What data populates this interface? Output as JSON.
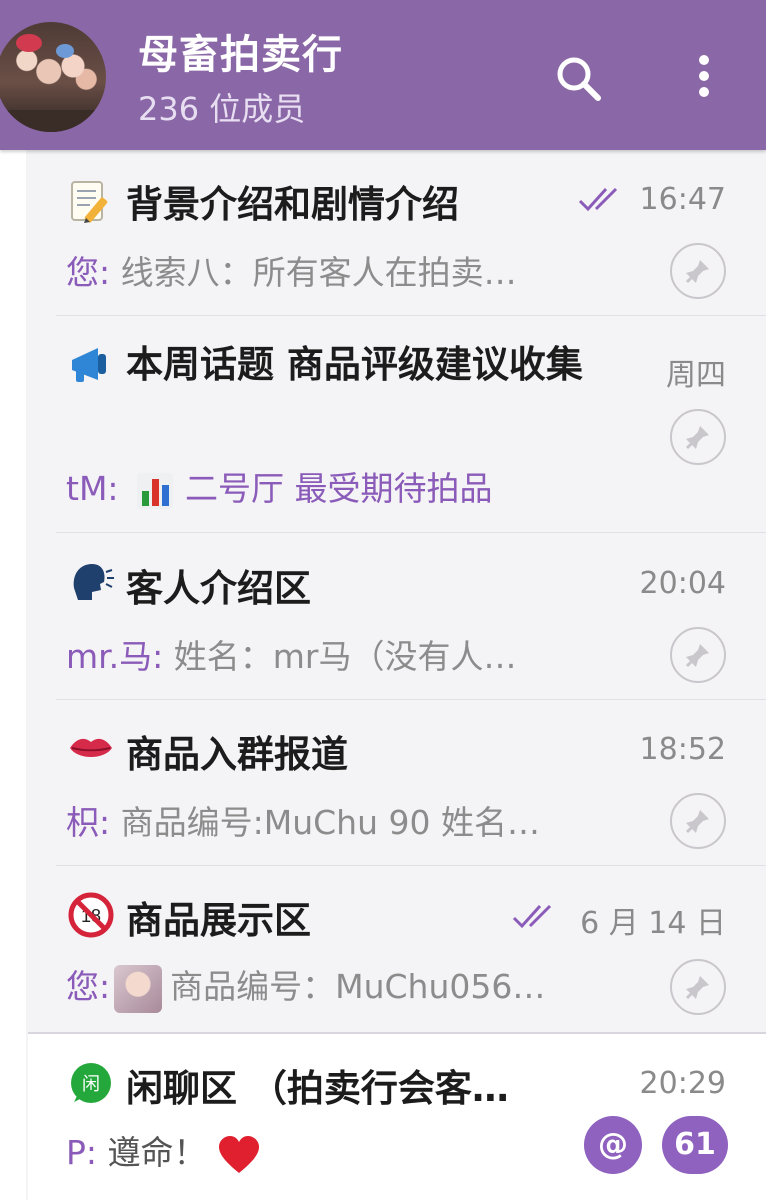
{
  "header": {
    "title": "母畜拍卖行",
    "subtitle": "236 位成员",
    "accent_color": "#8a67a6",
    "icons": [
      "avatar",
      "search-icon",
      "more-vert-icon"
    ]
  },
  "chats": [
    {
      "emoji": "memo-icon",
      "title": "背景介绍和剧情介绍",
      "time": "16:47",
      "read_ticks": true,
      "sender": "您:",
      "preview": " 线索八：所有客人在拍卖…",
      "pinned": true
    },
    {
      "emoji": "megaphone-icon",
      "title": "本周话题 商品评级建议收集",
      "time": "周四",
      "sender": "tM:",
      "preview_icon": "bar-chart-icon",
      "preview": "二号厅 最受期待拍品",
      "pinned": true
    },
    {
      "emoji": "speaking-head-icon",
      "title": "客人介绍区",
      "time": "20:04",
      "sender": "mr.马:",
      "preview": " 姓名：mr马（没有人…",
      "pinned": true
    },
    {
      "emoji": "lips-icon",
      "title": "商品入群报道",
      "time": "18:52",
      "sender": "枳:",
      "preview": " 商品编号:MuChu 90  姓名…",
      "pinned": true
    },
    {
      "emoji": "no-entry-icon",
      "title": "商品展示区",
      "time": "6 月 14 日",
      "read_ticks": true,
      "sender": "您:",
      "preview_icon": "image-thumbnail",
      "preview": "商品编号：MuChu056…",
      "pinned": true
    },
    {
      "emoji": "xian-badge-icon",
      "title": "闲聊区 （拍卖行会客…",
      "time": "20:29",
      "sender": "P:",
      "preview": " 遵命！",
      "preview_icon": "heart-icon",
      "mention_badge": "@",
      "unread_count": "61",
      "pinned": false
    }
  ]
}
